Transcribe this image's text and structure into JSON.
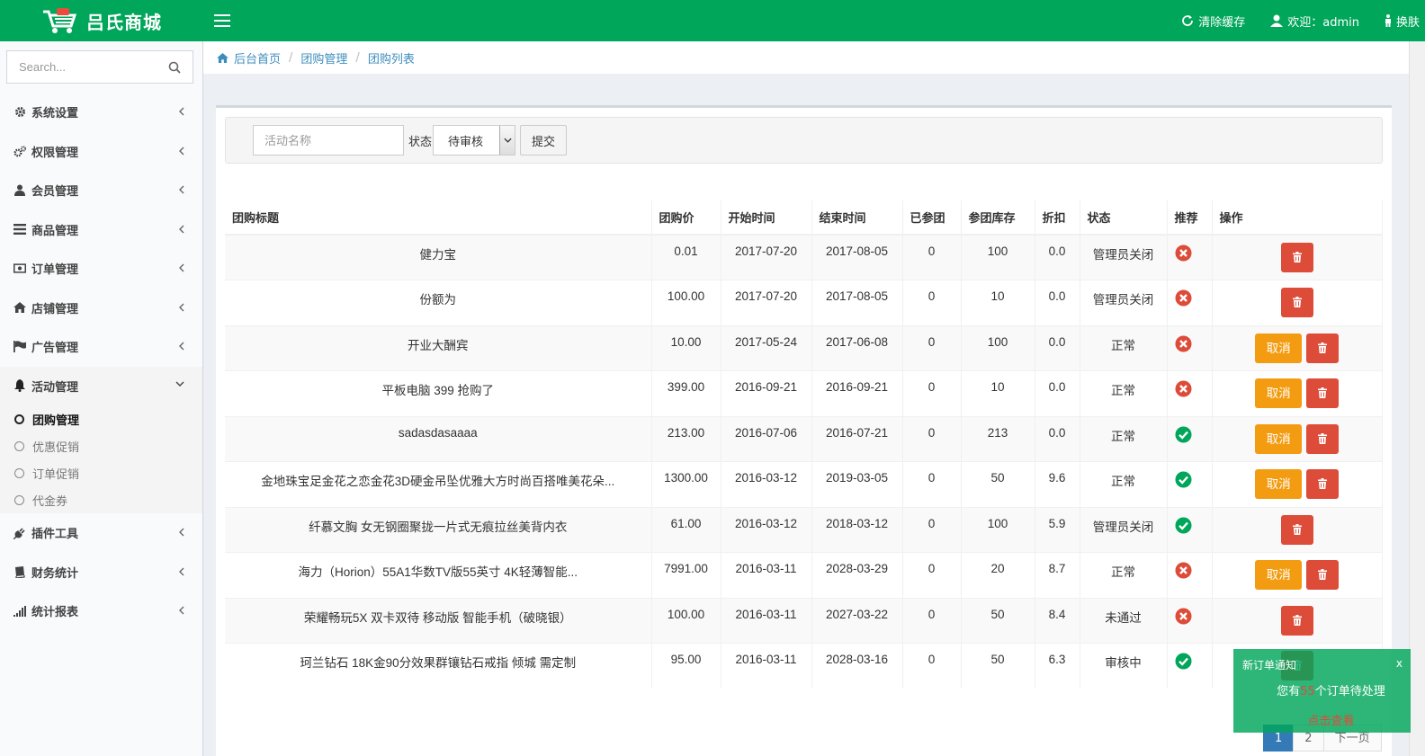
{
  "header": {
    "logo_text": "吕氏商城",
    "clear_cache": "清除缓存",
    "welcome": "欢迎：admin",
    "skin": "换肤"
  },
  "sidebar": {
    "search_placeholder": "Search...",
    "menu": [
      {
        "label": "系统设置",
        "icon": "gear-icon"
      },
      {
        "label": "权限管理",
        "icon": "gears-icon"
      },
      {
        "label": "会员管理",
        "icon": "user-icon"
      },
      {
        "label": "商品管理",
        "icon": "list-icon"
      },
      {
        "label": "订单管理",
        "icon": "money-icon"
      },
      {
        "label": "店铺管理",
        "icon": "home-icon"
      },
      {
        "label": "广告管理",
        "icon": "flag-icon"
      },
      {
        "label": "活动管理",
        "icon": "bell-icon"
      },
      {
        "label": "插件工具",
        "icon": "plug-icon"
      },
      {
        "label": "财务统计",
        "icon": "book-icon"
      },
      {
        "label": "统计报表",
        "icon": "signal-icon"
      }
    ],
    "submenu": [
      {
        "label": "团购管理"
      },
      {
        "label": "优惠促销"
      },
      {
        "label": "订单促销"
      },
      {
        "label": "代金券"
      }
    ]
  },
  "breadcrumb": {
    "home": "后台首页",
    "level1": "团购管理",
    "level2": "团购列表"
  },
  "filter": {
    "name_placeholder": "活动名称",
    "status_label": "状态",
    "status_value": "待审核",
    "submit": "提交"
  },
  "table": {
    "headers": [
      "团购标题",
      "团购价",
      "开始时间",
      "结束时间",
      "已参团",
      "参团库存",
      "折扣",
      "状态",
      "推荐",
      "操作"
    ],
    "cancel_label": "取消",
    "rows": [
      {
        "title": "健力宝",
        "price": "0.01",
        "start": "2017-07-20",
        "end": "2017-08-05",
        "joined": "0",
        "stock": "100",
        "discount": "0.0",
        "status": "管理员关闭",
        "recommend": false,
        "can_cancel": false
      },
      {
        "title": "份额为",
        "price": "100.00",
        "start": "2017-07-20",
        "end": "2017-08-05",
        "joined": "0",
        "stock": "10",
        "discount": "0.0",
        "status": "管理员关闭",
        "recommend": false,
        "can_cancel": false
      },
      {
        "title": "开业大酬宾",
        "price": "10.00",
        "start": "2017-05-24",
        "end": "2017-06-08",
        "joined": "0",
        "stock": "100",
        "discount": "0.0",
        "status": "正常",
        "recommend": false,
        "can_cancel": true
      },
      {
        "title": "平板电脑 399 抢购了",
        "price": "399.00",
        "start": "2016-09-21",
        "end": "2016-09-21",
        "joined": "0",
        "stock": "10",
        "discount": "0.0",
        "status": "正常",
        "recommend": false,
        "can_cancel": true
      },
      {
        "title": "sadasdasaaaa",
        "price": "213.00",
        "start": "2016-07-06",
        "end": "2016-07-21",
        "joined": "0",
        "stock": "213",
        "discount": "0.0",
        "status": "正常",
        "recommend": true,
        "can_cancel": true
      },
      {
        "title": "金地珠宝足金花之恋金花3D硬金吊坠优雅大方时尚百搭唯美花朵...",
        "price": "1300.00",
        "start": "2016-03-12",
        "end": "2019-03-05",
        "joined": "0",
        "stock": "50",
        "discount": "9.6",
        "status": "正常",
        "recommend": true,
        "can_cancel": true
      },
      {
        "title": "纤慕文胸 女无钢圈聚拢一片式无痕拉丝美背内衣",
        "price": "61.00",
        "start": "2016-03-12",
        "end": "2018-03-12",
        "joined": "0",
        "stock": "100",
        "discount": "5.9",
        "status": "管理员关闭",
        "recommend": true,
        "can_cancel": false
      },
      {
        "title": "海力（Horion）55A1华数TV版55英寸 4K轻薄智能...",
        "price": "7991.00",
        "start": "2016-03-11",
        "end": "2028-03-29",
        "joined": "0",
        "stock": "20",
        "discount": "8.7",
        "status": "正常",
        "recommend": false,
        "can_cancel": true
      },
      {
        "title": "荣耀畅玩5X 双卡双待 移动版 智能手机（破晓银）",
        "price": "100.00",
        "start": "2016-03-11",
        "end": "2027-03-22",
        "joined": "0",
        "stock": "50",
        "discount": "8.4",
        "status": "未通过",
        "recommend": false,
        "can_cancel": false
      },
      {
        "title": "珂兰钻石 18K金90分效果群镶钻石戒指 倾城 需定制",
        "price": "95.00",
        "start": "2016-03-11",
        "end": "2028-03-16",
        "joined": "0",
        "stock": "50",
        "discount": "6.3",
        "status": "审核中",
        "recommend": true,
        "can_cancel": false
      }
    ]
  },
  "notification": {
    "title": "新订单通知",
    "close": "x",
    "msg_prefix": "您有",
    "count": "55",
    "msg_suffix": "个订单待处理",
    "link": "点击查看"
  },
  "pagination": {
    "pages": [
      "1",
      "2"
    ],
    "next": "下一页"
  },
  "colors": {
    "brand": "#00a65a",
    "danger": "#dd4b39",
    "warning": "#f39c12",
    "success": "#00a65a"
  }
}
